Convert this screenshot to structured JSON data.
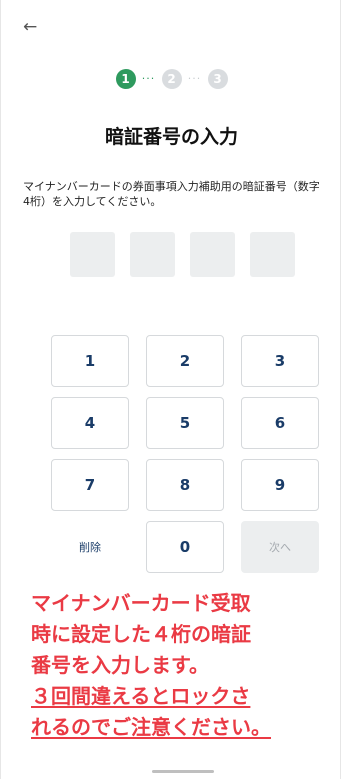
{
  "nav": {
    "back_icon": "←"
  },
  "stepper": {
    "steps": [
      {
        "label": "1",
        "state": "active"
      },
      {
        "label": "2",
        "state": "inactive"
      },
      {
        "label": "3",
        "state": "inactive"
      }
    ],
    "connector": "···"
  },
  "page": {
    "title": "暗証番号の入力",
    "description": "マイナンバーカードの券面事項入力補助用の暗証番号（数字4桁）を入力してください。"
  },
  "pin": {
    "length": 4,
    "entered": 0
  },
  "keypad": {
    "k1": "1",
    "k2": "2",
    "k3": "3",
    "k4": "4",
    "k5": "5",
    "k6": "6",
    "k7": "7",
    "k8": "8",
    "k9": "9",
    "delete": "削除",
    "k0": "0",
    "next": "次へ"
  },
  "callout": {
    "line1": "マイナンバーカード受取",
    "line2": "時に設定した４桁の暗証",
    "line3": "番号を入力します。",
    "line4": "３回間違えるとロックさ",
    "line5": "れるのでご注意ください。"
  },
  "colors": {
    "accent": "#2e9a5e",
    "callout": "#ea3a44",
    "key_text": "#1a3c68"
  }
}
